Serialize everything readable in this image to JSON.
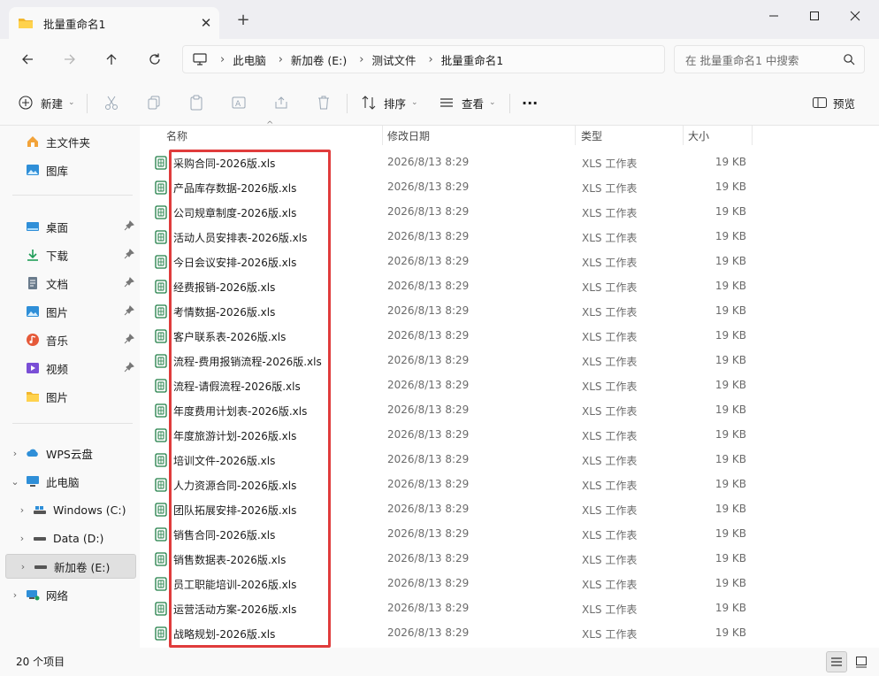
{
  "window": {
    "tab_title": "批量重命名1",
    "new_tab": "+"
  },
  "address": {
    "breadcrumbs": [
      "此电脑",
      "新加卷 (E:)",
      "测试文件",
      "批量重命名1"
    ],
    "search_placeholder": "在 批量重命名1 中搜索"
  },
  "toolbar": {
    "new_label": "新建",
    "sort_label": "排序",
    "view_label": "查看",
    "more_label": "···",
    "preview_label": "预览"
  },
  "sidebar": {
    "quick": [
      {
        "label": "主文件夹",
        "icon": "home-icon"
      },
      {
        "label": "图库",
        "icon": "gallery-icon"
      }
    ],
    "pinned": [
      {
        "label": "桌面",
        "icon": "desktop-icon",
        "color": "#2f8fd8"
      },
      {
        "label": "下载",
        "icon": "download-icon",
        "color": "#1f9d58"
      },
      {
        "label": "文档",
        "icon": "document-icon",
        "color": "#6a7b8c"
      },
      {
        "label": "图片",
        "icon": "pictures-icon",
        "color": "#2f8fd8"
      },
      {
        "label": "音乐",
        "icon": "music-icon",
        "color": "#e65a3a"
      },
      {
        "label": "视频",
        "icon": "video-icon",
        "color": "#7a4fd6"
      },
      {
        "label": "图片",
        "icon": "folder-icon",
        "color": "#f2b62e"
      }
    ],
    "tree": [
      {
        "label": "WPS云盘",
        "icon": "cloud-icon",
        "chevron": "›"
      },
      {
        "label": "此电脑",
        "icon": "computer-icon",
        "chevron": "⌄"
      },
      {
        "label": "Windows (C:)",
        "icon": "drive-icon",
        "chevron": "›"
      },
      {
        "label": "Data (D:)",
        "icon": "drive-icon",
        "chevron": "›"
      },
      {
        "label": "新加卷 (E:)",
        "icon": "drive-icon",
        "chevron": "›"
      },
      {
        "label": "网络",
        "icon": "network-icon",
        "chevron": "›"
      }
    ]
  },
  "columns": {
    "name": "名称",
    "modified": "修改日期",
    "type": "类型",
    "size": "大小"
  },
  "files": [
    {
      "name": "采购合同-2026版.xls",
      "modified": "2026/8/13 8:29",
      "type": "XLS 工作表",
      "size": "19 KB"
    },
    {
      "name": "产品库存数据-2026版.xls",
      "modified": "2026/8/13 8:29",
      "type": "XLS 工作表",
      "size": "19 KB"
    },
    {
      "name": "公司规章制度-2026版.xls",
      "modified": "2026/8/13 8:29",
      "type": "XLS 工作表",
      "size": "19 KB"
    },
    {
      "name": "活动人员安排表-2026版.xls",
      "modified": "2026/8/13 8:29",
      "type": "XLS 工作表",
      "size": "19 KB"
    },
    {
      "name": "今日会议安排-2026版.xls",
      "modified": "2026/8/13 8:29",
      "type": "XLS 工作表",
      "size": "19 KB"
    },
    {
      "name": "经费报销-2026版.xls",
      "modified": "2026/8/13 8:29",
      "type": "XLS 工作表",
      "size": "19 KB"
    },
    {
      "name": "考情数据-2026版.xls",
      "modified": "2026/8/13 8:29",
      "type": "XLS 工作表",
      "size": "19 KB"
    },
    {
      "name": "客户联系表-2026版.xls",
      "modified": "2026/8/13 8:29",
      "type": "XLS 工作表",
      "size": "19 KB"
    },
    {
      "name": "流程-费用报销流程-2026版.xls",
      "modified": "2026/8/13 8:29",
      "type": "XLS 工作表",
      "size": "19 KB"
    },
    {
      "name": "流程-请假流程-2026版.xls",
      "modified": "2026/8/13 8:29",
      "type": "XLS 工作表",
      "size": "19 KB"
    },
    {
      "name": "年度费用计划表-2026版.xls",
      "modified": "2026/8/13 8:29",
      "type": "XLS 工作表",
      "size": "19 KB"
    },
    {
      "name": "年度旅游计划-2026版.xls",
      "modified": "2026/8/13 8:29",
      "type": "XLS 工作表",
      "size": "19 KB"
    },
    {
      "name": "培训文件-2026版.xls",
      "modified": "2026/8/13 8:29",
      "type": "XLS 工作表",
      "size": "19 KB"
    },
    {
      "name": "人力资源合同-2026版.xls",
      "modified": "2026/8/13 8:29",
      "type": "XLS 工作表",
      "size": "19 KB"
    },
    {
      "name": "团队拓展安排-2026版.xls",
      "modified": "2026/8/13 8:29",
      "type": "XLS 工作表",
      "size": "19 KB"
    },
    {
      "name": "销售合同-2026版.xls",
      "modified": "2026/8/13 8:29",
      "type": "XLS 工作表",
      "size": "19 KB"
    },
    {
      "name": "销售数据表-2026版.xls",
      "modified": "2026/8/13 8:29",
      "type": "XLS 工作表",
      "size": "19 KB"
    },
    {
      "name": "员工职能培训-2026版.xls",
      "modified": "2026/8/13 8:29",
      "type": "XLS 工作表",
      "size": "19 KB"
    },
    {
      "name": "运营活动方案-2026版.xls",
      "modified": "2026/8/13 8:29",
      "type": "XLS 工作表",
      "size": "19 KB"
    },
    {
      "name": "战略规划-2026版.xls",
      "modified": "2026/8/13 8:29",
      "type": "XLS 工作表",
      "size": "19 KB"
    }
  ],
  "status": {
    "item_count": "20 个项目"
  },
  "colors": {
    "highlight": "#e03c3c",
    "xls_icon": "#1e7d45",
    "folder": "#f2b62e"
  }
}
